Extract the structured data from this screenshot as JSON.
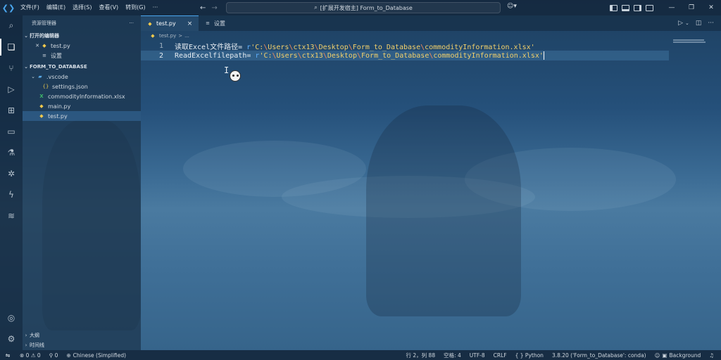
{
  "titlebar": {
    "menu": [
      "文件(F)",
      "编辑(E)",
      "选择(S)",
      "查看(V)",
      "转到(G)",
      "···"
    ],
    "search_text": "[扩展开发宿主] Form_to_Database",
    "icons": [
      "vscode-logo-icon",
      "back-arrow-icon",
      "forward-arrow-icon",
      "search-icon",
      "copilot-icon",
      "toggle-primary-sidebar-icon",
      "toggle-panel-icon",
      "toggle-secondary-sidebar-icon",
      "customize-layout-icon",
      "minimize-icon",
      "restore-icon",
      "close-icon"
    ]
  },
  "activitybar": {
    "icons": [
      "search-icon",
      "explorer-icon",
      "source-control-icon",
      "run-debug-icon",
      "extensions-icon",
      "remote-explorer-icon",
      "testing-icon",
      "bug-icon",
      "lightning-icon",
      "docker-icon",
      "account-icon",
      "manage-gear-icon"
    ]
  },
  "sidebar": {
    "title": "资源管理器",
    "more": "···",
    "open_editors": {
      "label": "打开的编辑器",
      "items": [
        {
          "name": "test.py",
          "icon": "python-file-icon"
        },
        {
          "name": "设置",
          "icon": "settings-file-icon"
        }
      ]
    },
    "workspace": {
      "label": "FORM_TO_DATABASE",
      "items": [
        {
          "name": ".vscode",
          "kind": "folder",
          "level": 0
        },
        {
          "name": "settings.json",
          "kind": "json",
          "level": 1
        },
        {
          "name": "commodityInformation.xlsx",
          "kind": "xlsx",
          "level": 0
        },
        {
          "name": "main.py",
          "kind": "py",
          "level": 0
        },
        {
          "name": "test.py",
          "kind": "py",
          "level": 0,
          "selected": true
        }
      ]
    },
    "bottom": [
      {
        "label": "大纲"
      },
      {
        "label": "时间线"
      }
    ]
  },
  "editor": {
    "tabs": [
      {
        "label": "test.py",
        "active": true,
        "close": "×"
      },
      {
        "label": "设置",
        "active": false
      }
    ],
    "breadcrumb": [
      "test.py",
      ">",
      "..."
    ],
    "lines": [
      {
        "number": "1",
        "var": "读取Excel文件路径",
        "op": "= ",
        "prefix": "r",
        "q": "'",
        "segments": [
          "C:",
          "\\",
          "Users",
          "\\",
          "ctx13",
          "\\",
          "Desktop",
          "\\",
          "Form_to_Database",
          "\\",
          "commodityInformation.xlsx"
        ],
        "end": "'"
      },
      {
        "number": "2",
        "var": "ReadExcelfilepath",
        "op": "= ",
        "prefix": "r",
        "q": "'",
        "segments": [
          "C:",
          "\\",
          "Users",
          "\\",
          "ctx13",
          "\\",
          "Desktop",
          "\\",
          "Form_to_Database",
          "\\",
          "commodityInformation.xlsx"
        ],
        "end": "'",
        "current": true
      }
    ]
  },
  "statusbar": {
    "problems": "⊗ 0 ⚠ 0",
    "ports": "⚲ 0",
    "language_pack": "Chinese (Simplified)",
    "position": "行 2，列 88",
    "spaces": "空格: 4",
    "encoding": "UTF-8",
    "eol": "CRLF",
    "language": "{ } Python",
    "interpreter": "3.8.20 ('Form_to_Database': conda)",
    "background": "Background"
  }
}
